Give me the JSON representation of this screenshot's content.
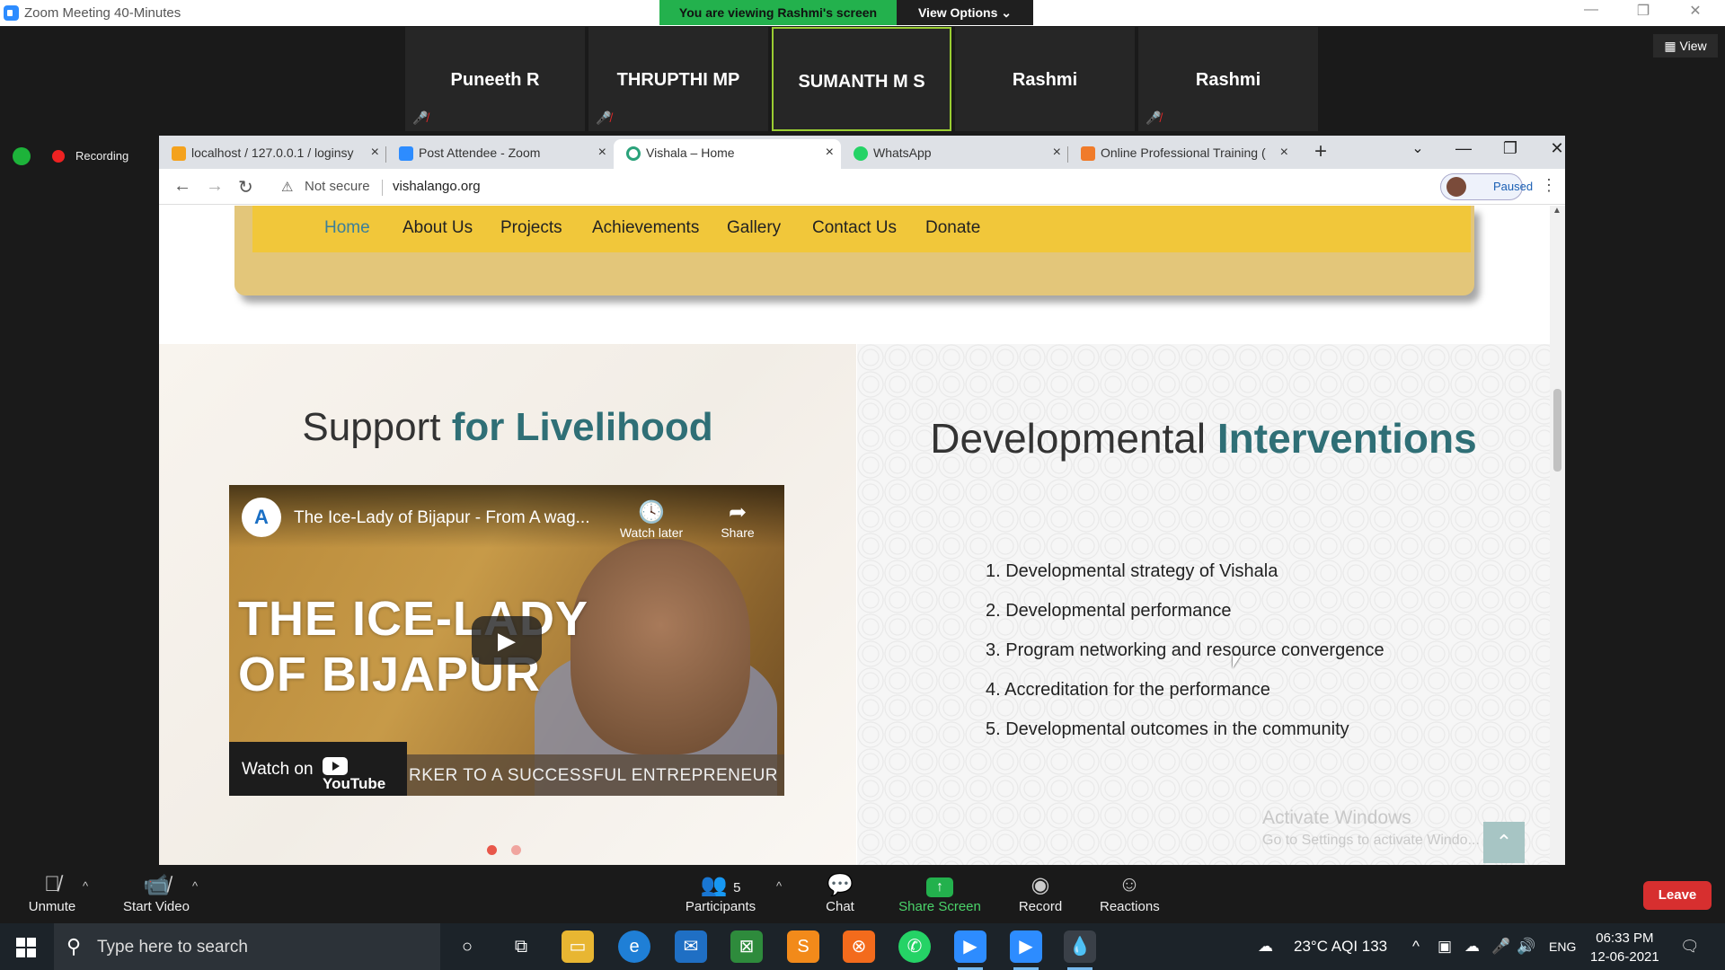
{
  "zoom": {
    "window_title": "Zoom Meeting 40-Minutes",
    "viewing_banner": "You are viewing Rashmi's screen",
    "view_options": "View Options ⌄",
    "view_button": "View",
    "recording": "Recording",
    "participants": [
      {
        "name": "Puneeth R",
        "muted": true
      },
      {
        "name": "THRUPTHI MP",
        "muted": true
      },
      {
        "name": "SUMANTH M S",
        "muted": false,
        "active": true
      },
      {
        "name": "Rashmi",
        "muted": false
      },
      {
        "name": "Rashmi",
        "muted": true
      }
    ]
  },
  "browser": {
    "tabs": [
      {
        "title": "localhost / 127.0.0.1 / loginsy",
        "icon": "phpmyadmin-icon"
      },
      {
        "title": "Post Attendee - Zoom",
        "icon": "zoom-icon"
      },
      {
        "title": "Vishala – Home",
        "icon": "vishala-icon",
        "active": true
      },
      {
        "title": "WhatsApp",
        "icon": "whatsapp-icon"
      },
      {
        "title": "Online Professional Training (",
        "icon": "training-icon"
      }
    ],
    "security": "Not secure",
    "url": "vishalango.org",
    "profile_status": "Paused"
  },
  "site": {
    "nav": [
      "Home",
      "About Us",
      "Projects",
      "Achievements",
      "Gallery",
      "Contact Us",
      "Donate"
    ],
    "left_heading_plain": "Support ",
    "left_heading_bold": "for Livelihood",
    "right_heading_plain": "Developmental ",
    "right_heading_bold": "Interventions",
    "video": {
      "channel_initial": "A",
      "title": "The Ice-Lady of Bijapur - From A wag...",
      "watch_later": "Watch later",
      "share": "Share",
      "overlay_line1": "THE ICE-LADY",
      "overlay_line2": "OF BIJAPUR",
      "watch_on": "Watch on",
      "youtube": "YouTube",
      "subtitle_strip": "RKER TO A SUCCESSFUL ENTREPRENEUR"
    },
    "interventions": [
      "1. Developmental strategy of Vishala",
      "2. Developmental performance",
      "3. Program networking and resource convergence",
      "4. Accreditation for the performance",
      "5. Developmental outcomes in the community"
    ],
    "activate_windows": "Activate Windows",
    "activate_windows_sub": "Go to Settings to activate Windo..."
  },
  "toolbar": {
    "unmute": "Unmute",
    "start_video": "Start Video",
    "participants": "Participants",
    "participants_count": "5",
    "chat": "Chat",
    "share_screen": "Share Screen",
    "record": "Record",
    "reactions": "Reactions",
    "leave": "Leave"
  },
  "taskbar": {
    "search_placeholder": "Type here to search",
    "weather": "23°C  AQI 133",
    "language": "ENG",
    "time": "06:33 PM",
    "date": "12-06-2021"
  },
  "colors": {
    "zoom_green": "#23b14d",
    "nav_yellow": "#f1c73a",
    "heading_teal": "#2f6f76",
    "leave_red": "#d72f2f"
  }
}
